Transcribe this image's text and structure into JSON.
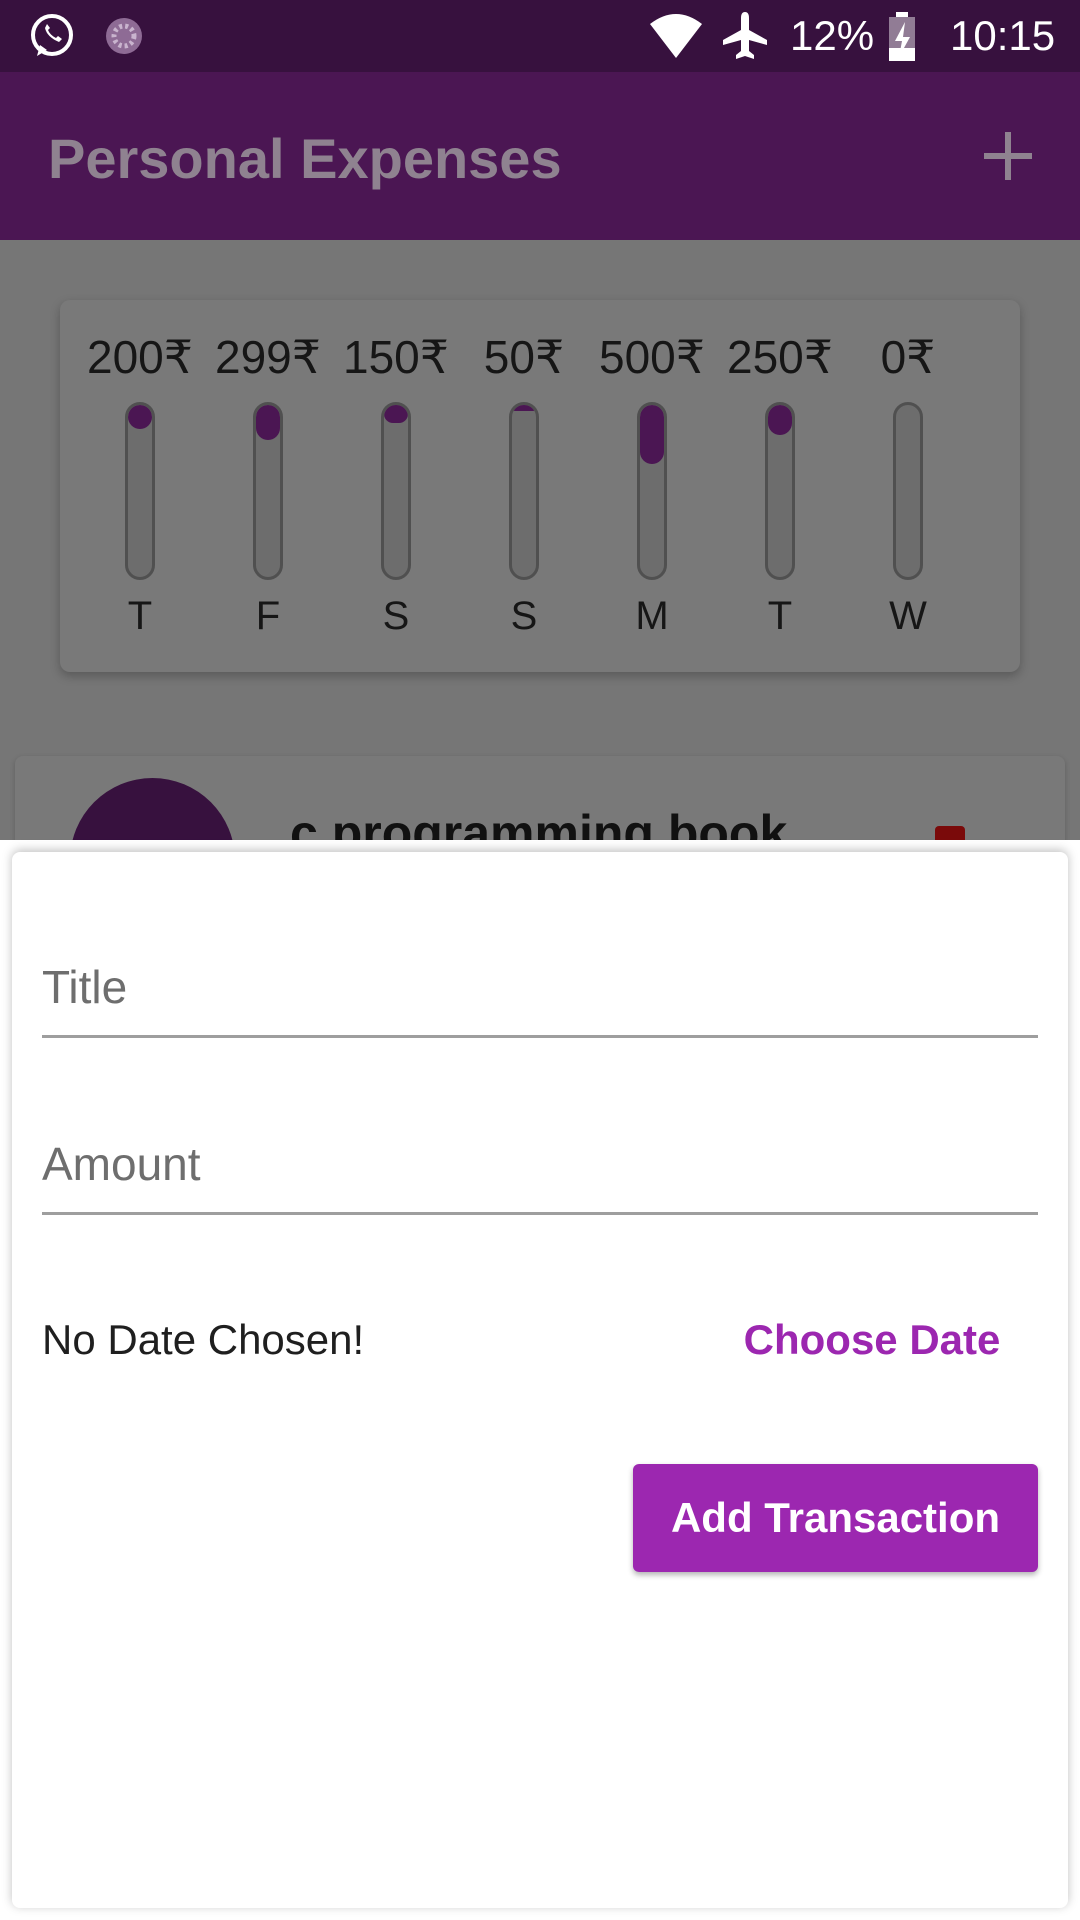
{
  "status_bar": {
    "battery_percent": "12%",
    "time": "10:15",
    "icons": [
      "whatsapp-icon",
      "sync-icon",
      "wifi-icon",
      "airplane-icon",
      "battery-charging-icon"
    ]
  },
  "app_bar": {
    "title": "Personal Expenses",
    "add_icon": "plus-icon"
  },
  "chart_data": {
    "type": "bar",
    "categories": [
      "T",
      "F",
      "S",
      "S",
      "M",
      "T",
      "W"
    ],
    "labels": [
      "200₹",
      "299₹",
      "150₹",
      "50₹",
      "500₹",
      "250₹",
      "0₹"
    ],
    "values": [
      200,
      299,
      150,
      50,
      500,
      250,
      0
    ],
    "unit": "₹",
    "colors": {
      "fill": "#4b1653",
      "track": "#6d6d6d"
    }
  },
  "transaction": {
    "title": "c programming book"
  },
  "form": {
    "title_placeholder": "Title",
    "amount_placeholder": "Amount",
    "date_text": "No Date Chosen!",
    "choose_date_label": "Choose Date",
    "submit_label": "Add Transaction"
  },
  "colors": {
    "primary": "#9c27b0",
    "app_bar": "#4b1653",
    "status_bar": "#37113e"
  }
}
